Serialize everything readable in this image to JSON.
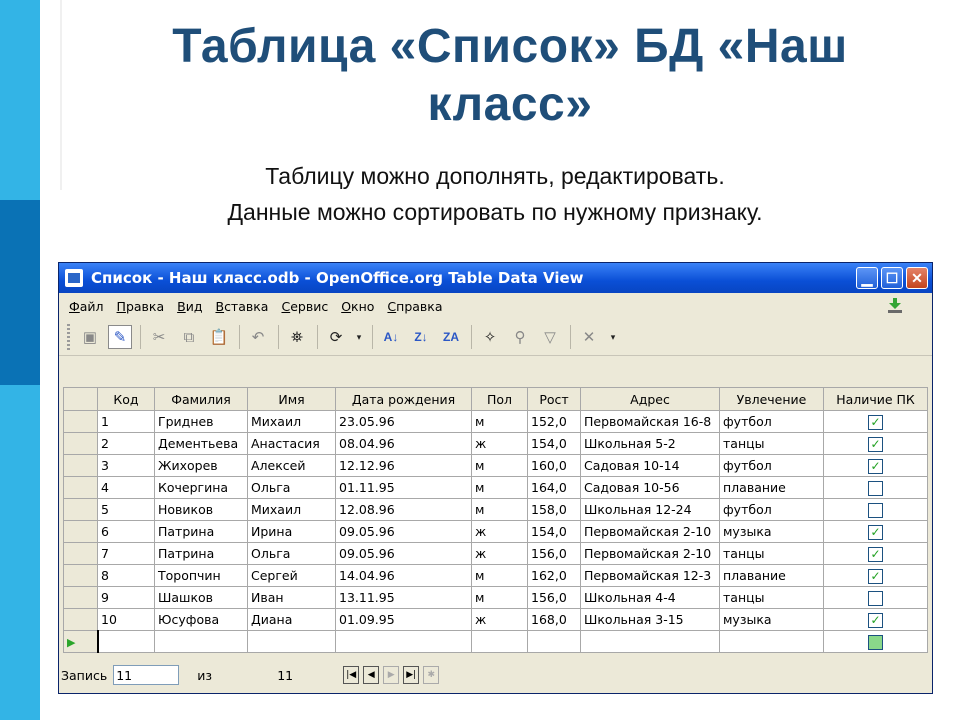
{
  "slide": {
    "title_line1": "Таблица «Список»  БД «Наш",
    "title_line2": "класс»",
    "subtitle_line1": "Таблицу можно дополнять, редактировать.",
    "subtitle_line2": "Данные можно сортировать по нужному признаку."
  },
  "window": {
    "title": "Список - Наш класс.odb - OpenOffice.org Table Data View",
    "menu": [
      "Файл",
      "Правка",
      "Вид",
      "Вставка",
      "Сервис",
      "Окно",
      "Справка"
    ],
    "columns": [
      "Код",
      "Фамилия",
      "Имя",
      "Дата рождения",
      "Пол",
      "Рост",
      "Адрес",
      "Увлечение",
      "Наличие ПК"
    ],
    "rows": [
      {
        "id": "1",
        "last": "Гриднев",
        "first": "Михаил",
        "dob": "23.05.96",
        "sex": "м",
        "height": "152,0",
        "address": "Первомайская 16-8",
        "hobby": "футбол",
        "pc": true
      },
      {
        "id": "2",
        "last": "Дементьева",
        "first": "Анастасия",
        "dob": "08.04.96",
        "sex": "ж",
        "height": "154,0",
        "address": "Школьная 5-2",
        "hobby": "танцы",
        "pc": true
      },
      {
        "id": "3",
        "last": "Жихорев",
        "first": "Алексей",
        "dob": "12.12.96",
        "sex": "м",
        "height": "160,0",
        "address": "Садовая 10-14",
        "hobby": "футбол",
        "pc": true
      },
      {
        "id": "4",
        "last": "Кочергина",
        "first": "Ольга",
        "dob": "01.11.95",
        "sex": "м",
        "height": "164,0",
        "address": "Садовая 10-56",
        "hobby": "плавание",
        "pc": false
      },
      {
        "id": "5",
        "last": "Новиков",
        "first": "Михаил",
        "dob": "12.08.96",
        "sex": "м",
        "height": "158,0",
        "address": "Школьная 12-24",
        "hobby": "футбол",
        "pc": false
      },
      {
        "id": "6",
        "last": "Патрина",
        "first": "Ирина",
        "dob": "09.05.96",
        "sex": "ж",
        "height": "154,0",
        "address": "Первомайская 2-10",
        "hobby": "музыка",
        "pc": true
      },
      {
        "id": "7",
        "last": "Патрина",
        "first": "Ольга",
        "dob": "09.05.96",
        "sex": "ж",
        "height": "156,0",
        "address": "Первомайская 2-10",
        "hobby": "танцы",
        "pc": true
      },
      {
        "id": "8",
        "last": "Торопчин",
        "first": "Сергей",
        "dob": "14.04.96",
        "sex": "м",
        "height": "162,0",
        "address": "Первомайская 12-3",
        "hobby": "плавание",
        "pc": true
      },
      {
        "id": "9",
        "last": "Шашков",
        "first": "Иван",
        "dob": "13.11.95",
        "sex": "м",
        "height": "156,0",
        "address": "Школьная 4-4",
        "hobby": "танцы",
        "pc": false
      },
      {
        "id": "10",
        "last": "Юсуфова",
        "first": "Диана",
        "dob": "01.09.95",
        "sex": "ж",
        "height": "168,0",
        "address": "Школьная 3-15",
        "hobby": "музыка",
        "pc": true
      }
    ],
    "navigation": {
      "record_label": "Запись",
      "record_value": "11",
      "of_label": "из",
      "total": "11"
    }
  }
}
